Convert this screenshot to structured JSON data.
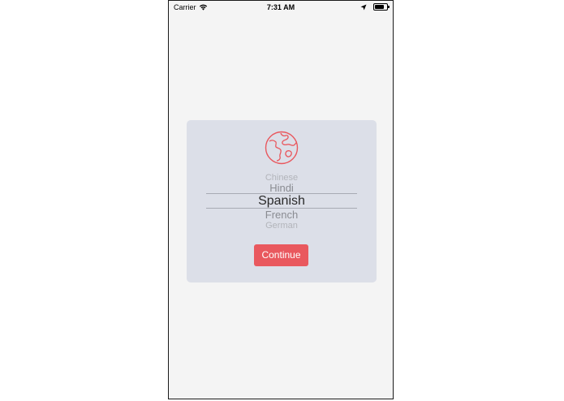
{
  "status_bar": {
    "carrier": "Carrier",
    "time": "7:31 AM",
    "icons": [
      "wifi-icon",
      "location-icon",
      "battery-icon"
    ]
  },
  "language_picker": {
    "icon": "globe-icon",
    "options": [
      "Chinese",
      "Hindi",
      "Spanish",
      "French",
      "German"
    ],
    "selected": "Spanish"
  },
  "continue_label": "Continue",
  "colors": {
    "accent": "#e9585e",
    "card_background": "#dcdfe8",
    "screen_background": "#f4f4f4"
  }
}
